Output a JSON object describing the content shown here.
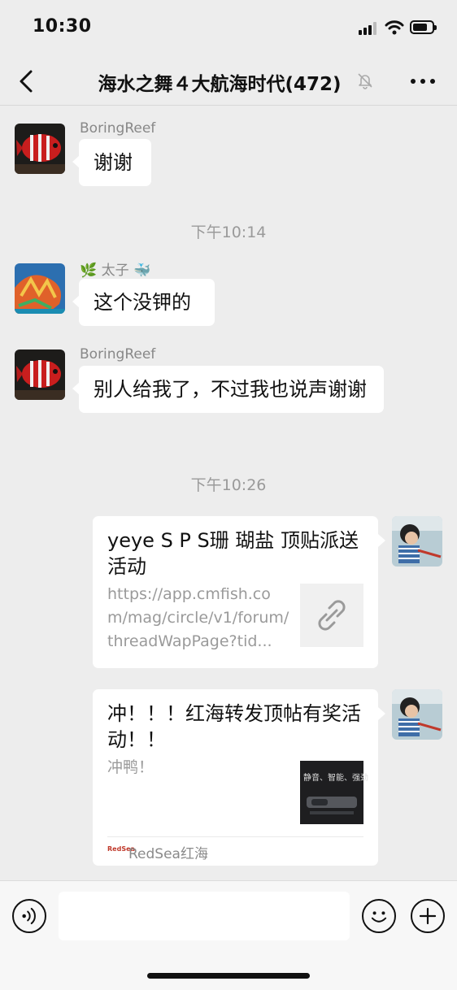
{
  "status_bar": {
    "time": "10:30"
  },
  "header": {
    "title": "海水之舞４大航海时代(472)"
  },
  "messages": [
    {
      "sender": "BoringReef",
      "text": "谢谢"
    },
    {
      "timestamp": "下午10:14"
    },
    {
      "sender_leaf": "🌿",
      "sender_name": "太子",
      "sender_whale": "🐳",
      "text": "这个没钾的"
    },
    {
      "sender": "BoringReef",
      "text": "别人给我了，不过我也说声谢谢"
    },
    {
      "timestamp": "下午10:26"
    },
    {
      "card_title": "yeye S P S珊 瑚盐 顶贴派送活动",
      "card_desc": "https://app.cmfish.com/mag/circle/v1/forum/threadWapPage?tid..."
    },
    {
      "card_title": "冲！！！红海转发顶帖有奖活动！！",
      "card_desc": "冲鸭！",
      "thumb_text": "静音、智能、强劲",
      "footer_brand": "RedSea",
      "footer_source": "RedSea红海"
    }
  ],
  "input_bar": {
    "placeholder": ""
  },
  "icons": {
    "back": "chevron-left-icon",
    "mute": "bell-slash-icon",
    "more": "more-dots-icon",
    "voice": "voice-icon",
    "emoji": "emoji-icon",
    "plus": "plus-icon",
    "link": "link-icon"
  },
  "colors": {
    "background": "#ededed",
    "bubble": "#ffffff",
    "timestamp": "#9a9a9a",
    "sender": "#888888"
  }
}
